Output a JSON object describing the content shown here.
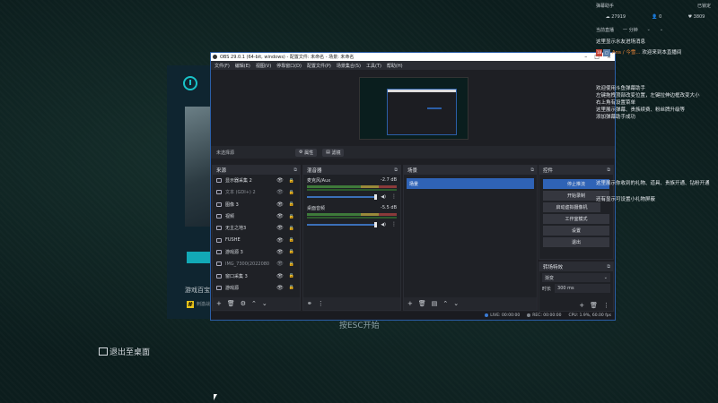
{
  "bg_app": {
    "title": "游戏百宝",
    "tag": "刺激战"
  },
  "desktop": {
    "exit_label": "退出至桌面",
    "hint": "按ESC开始"
  },
  "obs": {
    "title": "OBS 29.0.1 (64-bit, windows) - 配置文件: 未命名 - 场景: 未命名",
    "menu": [
      "文件(F)",
      "编辑(E)",
      "视图(V)",
      "停靠窗口(D)",
      "配置文件(P)",
      "场景集合(S)",
      "工具(T)",
      "帮助(H)"
    ],
    "toolbar": {
      "no_source": "未选择源",
      "properties": "属性",
      "filters": "滤镜"
    },
    "sources": {
      "header": "来源",
      "items": [
        {
          "name": "显示器采集 2",
          "dim": false
        },
        {
          "name": "文本 (GDI+) 2",
          "dim": true
        },
        {
          "name": "图像 3",
          "dim": false
        },
        {
          "name": "视频",
          "dim": false
        },
        {
          "name": "无主之地3",
          "dim": false
        },
        {
          "name": "FUSHE",
          "dim": false
        },
        {
          "name": "游戏源 3",
          "dim": false
        },
        {
          "name": "IMG_7300(2022080",
          "dim": true
        },
        {
          "name": "窗口采集 3",
          "dim": false
        },
        {
          "name": "游戏源",
          "dim": false
        }
      ]
    },
    "mixer": {
      "header": "混音器",
      "channels": [
        {
          "name": "麦克风/Aux",
          "db": "-2.7 dB"
        },
        {
          "name": "桌面音频",
          "db": "-5.5 dB"
        }
      ]
    },
    "scenes": {
      "header": "场景",
      "items": [
        "场景"
      ]
    },
    "controls": {
      "header": "控件",
      "buttons": [
        {
          "label": "停止推流",
          "active": true
        },
        {
          "label": "开始录制",
          "active": false
        },
        {
          "label": "启动虚拟摄像机",
          "active": false
        },
        {
          "label": "工作室模式",
          "active": false
        },
        {
          "label": "设置",
          "active": false
        },
        {
          "label": "退出",
          "active": false
        }
      ]
    },
    "transitions": {
      "header": "转场特效",
      "type": "渐变",
      "duration_label": "时长",
      "duration": "300 ms"
    },
    "status": {
      "live": "LIVE: 00:00:00",
      "rec": "REC: 00:00:00",
      "cpu": "CPU: 1.9%, 60.00 fps"
    }
  },
  "chat": {
    "top_left": "弹幕助手",
    "top_right": "已锁定",
    "stats": [
      "27919",
      "0",
      "3809"
    ],
    "tabs": [
      "当前直播",
      "一 分钟"
    ],
    "messages": [
      {
        "text": "这里显示水友进场消息"
      },
      {
        "prefix": "Ans / 今雪...",
        "text": "欢迎来到本直播间"
      },
      {
        "text": "欢迎使用斗鱼弹幕助手"
      },
      {
        "text": "左键拖拽顶部改变位置，左键拉伸边框改变大小"
      },
      {
        "text": "右上角有设置菜单"
      },
      {
        "text": "这里展示弹幕、贵族续费、粉丝牌升级等"
      },
      {
        "text": "添加弹幕助手成功"
      },
      {
        "text": "这里展示你收到的礼物、道具、贵族开通、钻粉开通"
      },
      {
        "text": "还有显示可设置小礼物屏蔽"
      }
    ]
  },
  "colors": {
    "accent": "#2f63b6",
    "cyan": "#12a9b6",
    "orange": "#f08a3a"
  }
}
